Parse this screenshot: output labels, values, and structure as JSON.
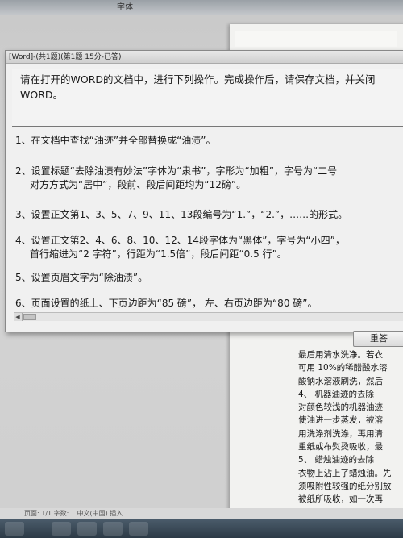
{
  "word": {
    "toolbar_group_label": "字体",
    "document_lines": [
      "最后用清水洗净。若衣",
      "可用 10%的稀醋酸水溶",
      "酸钠水溶液刷洗，然后",
      "4、  机器油迹的去除",
      "对颜色较浅的机器油迹",
      "使油进一步蒸发，被溶",
      "用洗涤剂洗涤，再用清",
      "重纸或布熨烫吸收，最",
      "5、  蜡烛油迹的去除",
      "衣物上沾上了蜡烛油。先",
      "须吸附性较强的纸分别放",
      "被纸所吸收，如一次再"
    ],
    "status_text": "页面: 1/1    字数: 1    中文(中国)    插入"
  },
  "dialog": {
    "title": "[Word]-(共1题)(第1题 15分-已答)",
    "intro": "请在打开的WORD的文档中，进行下列操作。完成操作后，请保存文档，并关闭WORD。",
    "tasks": [
      {
        "line1": "1、在文档中查找“油迹”并全部替换成“油渍”。",
        "line2": ""
      },
      {
        "line1": "2、设置标题“去除油渍有妙法”字体为“隶书”，字形为“加粗”，字号为“二号",
        "line2": "对方方式为“居中”，段前、段后间距均为“12磅”。"
      },
      {
        "line1": "3、设置正文第1、3、5、7、9、11、13段编号为“1.”，“2.”，……的形式。",
        "line2": ""
      },
      {
        "line1": "4、设置正文第2、4、6、8、10、12、14段字体为“黑体”，字号为“小四”，",
        "line2": "首行缩进为“2 字符”，行距为“1.5倍”，段后间距“0.5 行”。"
      },
      {
        "line1": "5、设置页眉文字为“除油渍”。",
        "line2": ""
      },
      {
        "line1": "6、页面设置的纸上、下页边距为“85 磅”， 左、右页边距为“80 磅”。",
        "line2": ""
      }
    ],
    "redo_button": "重答"
  }
}
